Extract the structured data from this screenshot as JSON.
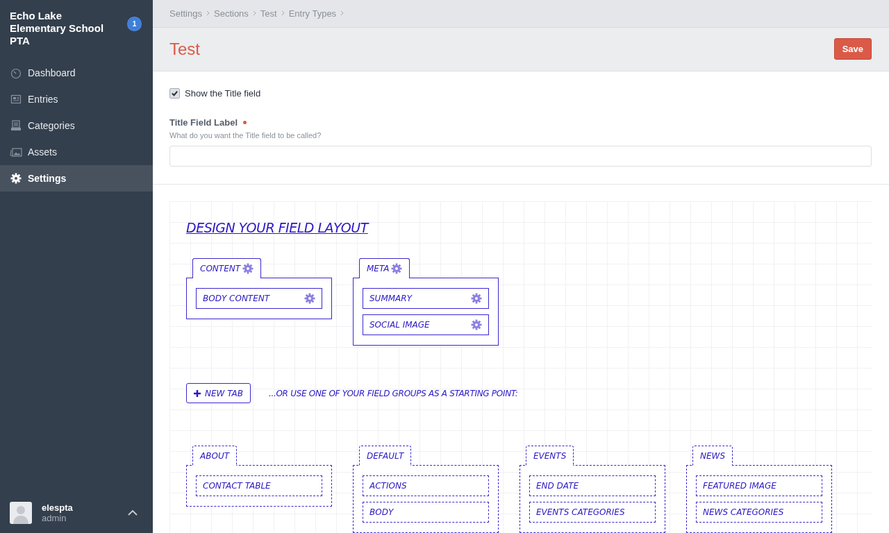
{
  "sidebar": {
    "site_name": "Echo Lake Elementary School PTA",
    "badge": "1",
    "items": [
      {
        "label": "Dashboard",
        "selected": false
      },
      {
        "label": "Entries",
        "selected": false
      },
      {
        "label": "Categories",
        "selected": false
      },
      {
        "label": "Assets",
        "selected": false
      },
      {
        "label": "Settings",
        "selected": true
      }
    ],
    "user": {
      "name": "elespta",
      "role": "admin"
    }
  },
  "breadcrumbs": [
    "Settings",
    "Sections",
    "Test",
    "Entry Types"
  ],
  "page_title": "Test",
  "save_button": "Save",
  "show_title_field": {
    "label": "Show the Title field",
    "checked": true
  },
  "title_field_label": {
    "label": "Title Field Label",
    "required": true,
    "instructions": "What do you want the Title field to be called?"
  },
  "layout": {
    "heading": "DESIGN YOUR FIELD LAYOUT",
    "tabs": [
      {
        "name": "CONTENT",
        "fields": [
          "BODY CONTENT"
        ]
      },
      {
        "name": "META",
        "fields": [
          "SUMMARY",
          "SOCIAL IMAGE"
        ]
      }
    ],
    "new_tab_button": "NEW TAB",
    "groups_hint": "...OR USE ONE OF YOUR FIELD GROUPS AS A STARTING POINT:",
    "groups": [
      {
        "name": "ABOUT",
        "fields": [
          "CONTACT TABLE"
        ]
      },
      {
        "name": "DEFAULT",
        "fields": [
          "ACTIONS",
          "BODY"
        ]
      },
      {
        "name": "EVENTS",
        "fields": [
          "END DATE",
          "EVENTS CATEGORIES"
        ]
      },
      {
        "name": "NEWS",
        "fields": [
          "FEATURED IMAGE",
          "NEWS CATEGORIES"
        ]
      }
    ]
  }
}
